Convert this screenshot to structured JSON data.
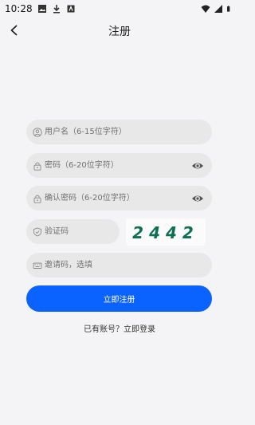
{
  "status_bar": {
    "time": "10:28",
    "icons": [
      "image-icon",
      "download-icon",
      "app-icon",
      "wifi-icon",
      "signal-icon",
      "battery-icon"
    ]
  },
  "header": {
    "title": "注册",
    "back_icon": "chevron-left-icon"
  },
  "form": {
    "username_placeholder": "用户名（6-15位字符）",
    "password_placeholder": "密码（6-20位字符）",
    "confirm_password_placeholder": "确认密码（6-20位字符）",
    "captcha_placeholder": "验证码",
    "captcha_code": "2442",
    "invite_placeholder": "邀请码，选填"
  },
  "actions": {
    "submit_label": "立即注册",
    "login_link": "已有账号？立即登录"
  },
  "colors": {
    "accent": "#0b63ff",
    "captcha_text": "#0e6f52",
    "field_bg": "#e8e8e8",
    "page_bg": "#f4f4f6"
  }
}
